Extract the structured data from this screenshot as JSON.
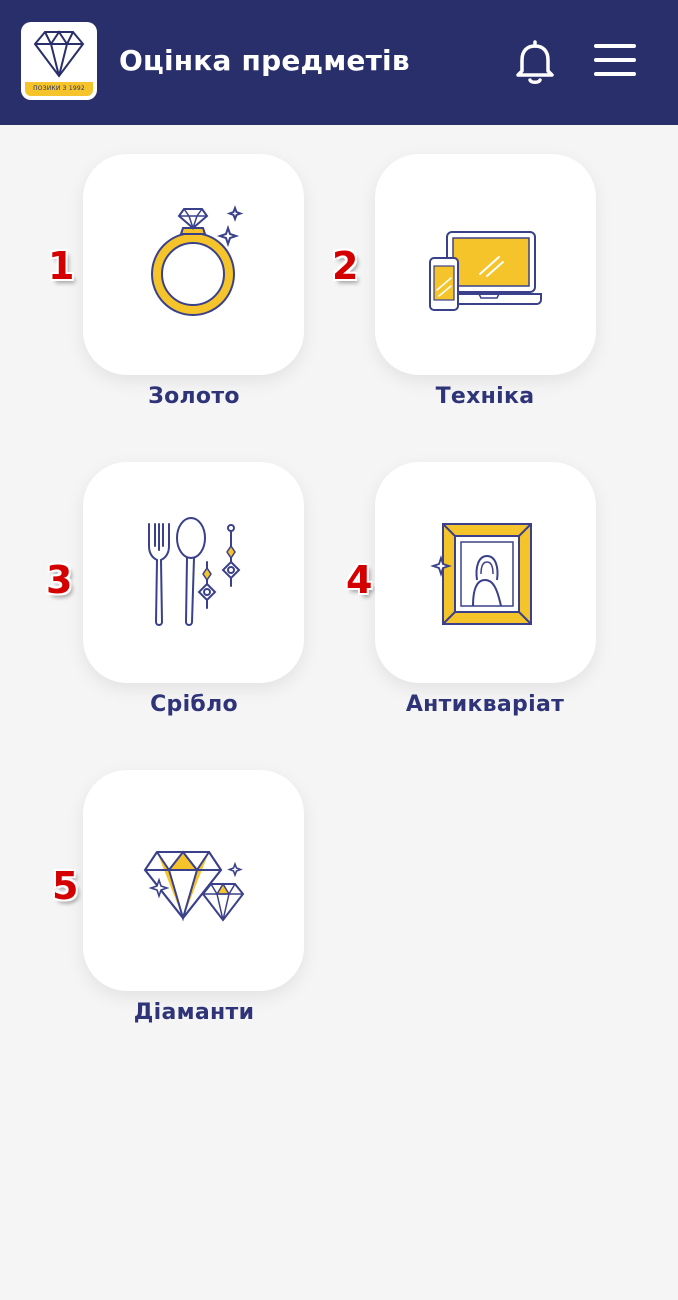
{
  "header": {
    "title": "Оцінка предметів",
    "logo_tagline": "ПОЗИКИ З 1992",
    "icons": {
      "notifications": "bell-icon",
      "menu": "hamburger-menu-icon"
    }
  },
  "categories": [
    {
      "number": "1",
      "label": "Золото",
      "icon": "gold-ring-icon"
    },
    {
      "number": "2",
      "label": "Техніка",
      "icon": "electronics-icon"
    },
    {
      "number": "3",
      "label": "Срібло",
      "icon": "silverware-icon"
    },
    {
      "number": "4",
      "label": "Антикваріат",
      "icon": "antique-painting-icon"
    },
    {
      "number": "5",
      "label": "Діаманти",
      "icon": "diamonds-icon"
    }
  ],
  "colors": {
    "header_bg": "#292f6b",
    "accent_yellow": "#f4c42a",
    "label_text": "#2f3479",
    "number_red": "#d40000"
  }
}
